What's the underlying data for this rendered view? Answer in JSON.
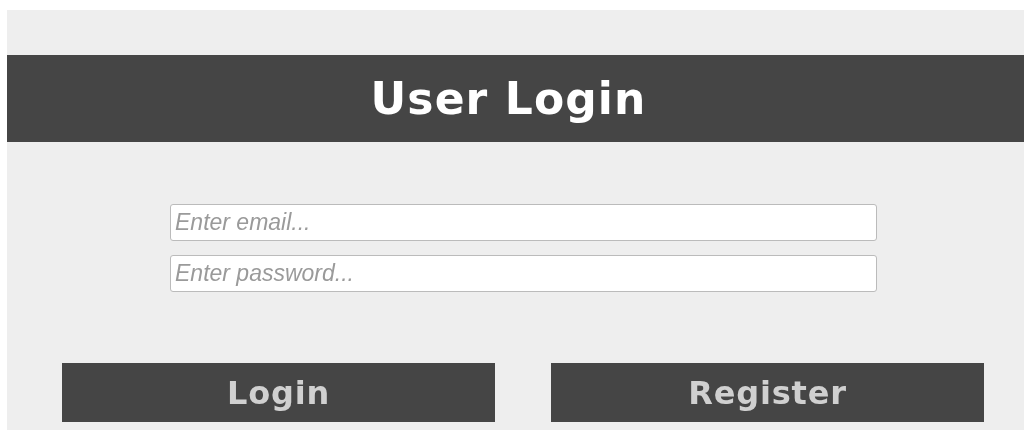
{
  "header": {
    "title": "User Login"
  },
  "fields": [
    {
      "placeholder": "Enter email..."
    },
    {
      "placeholder": "Enter password..."
    }
  ],
  "buttons": [
    {
      "label": "Login"
    },
    {
      "label": "Register"
    }
  ]
}
